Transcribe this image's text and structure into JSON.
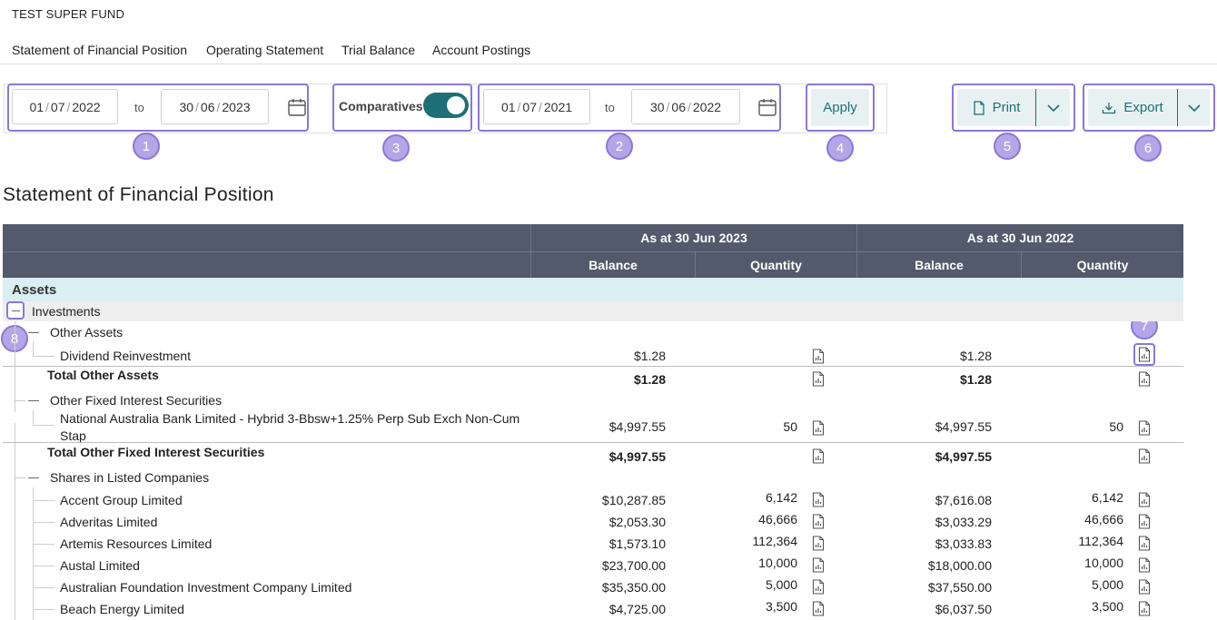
{
  "fund_name": "TEST SUPER FUND",
  "tabs": [
    {
      "label": "Statement of Financial Position"
    },
    {
      "label": "Operating Statement"
    },
    {
      "label": "Trial Balance"
    },
    {
      "label": "Account Postings"
    }
  ],
  "toolbar": {
    "period1": {
      "from_dd": "01",
      "from_mm": "07",
      "from_yyyy": "2022",
      "to_label": "to",
      "to_dd": "30",
      "to_mm": "06",
      "to_yyyy": "2023"
    },
    "comparatives_label": "Comparatives",
    "comparatives_on": true,
    "period2": {
      "from_dd": "01",
      "from_mm": "07",
      "from_yyyy": "2021",
      "to_label": "to",
      "to_dd": "30",
      "to_mm": "06",
      "to_yyyy": "2022"
    },
    "apply_label": "Apply",
    "print_label": "Print",
    "export_label": "Export",
    "date_sep": "/"
  },
  "badges": [
    "1",
    "2",
    "3",
    "4",
    "5",
    "6",
    "7",
    "8"
  ],
  "page_title": "Statement of Financial Position",
  "table": {
    "col_group_1": "As at 30 Jun 2023",
    "col_group_2": "As at 30 Jun 2022",
    "balance_label": "Balance",
    "quantity_label": "Quantity",
    "assets_label": "Assets",
    "investments_label": "Investments",
    "other_assets_label": "Other Assets",
    "dividend_row": {
      "name": "Dividend Reinvestment",
      "bal1": "$1.28",
      "qty1": "",
      "bal2": "$1.28",
      "qty2": ""
    },
    "total_other_assets": {
      "name": "Total Other Assets",
      "bal1": "$1.28",
      "bal2": "$1.28"
    },
    "ofis_label": "Other Fixed Interest Securities",
    "nab_row": {
      "name_line1": "National Australia Bank Limited - Hybrid 3-Bbsw+1.25% Perp Sub Exch Non-Cum",
      "name_line2": "Stap",
      "bal1": "$4,997.55",
      "qty1": "50",
      "bal2": "$4,997.55",
      "qty2": "50"
    },
    "total_ofis": {
      "name": "Total Other Fixed Interest Securities",
      "bal1": "$4,997.55",
      "bal2": "$4,997.55"
    },
    "shares_label": "Shares in Listed Companies",
    "shares": [
      {
        "name": "Accent Group Limited",
        "bal1": "$10,287.85",
        "qty1": "6,142",
        "bal2": "$7,616.08",
        "qty2": "6,142"
      },
      {
        "name": "Adveritas Limited",
        "bal1": "$2,053.30",
        "qty1": "46,666",
        "bal2": "$3,033.29",
        "qty2": "46,666"
      },
      {
        "name": "Artemis Resources Limited",
        "bal1": "$1,573.10",
        "qty1": "112,364",
        "bal2": "$3,033.83",
        "qty2": "112,364"
      },
      {
        "name": "Austal Limited",
        "bal1": "$23,700.00",
        "qty1": "10,000",
        "bal2": "$18,000.00",
        "qty2": "10,000"
      },
      {
        "name": "Australian Foundation Investment Company Limited",
        "bal1": "$35,350.00",
        "qty1": "5,000",
        "bal2": "$37,550.00",
        "qty2": "5,000"
      },
      {
        "name": "Beach Energy Limited",
        "bal1": "$4,725.00",
        "qty1": "3,500",
        "bal2": "$6,037.50",
        "qty2": "3,500"
      }
    ]
  },
  "colors": {
    "accent": "#1f6f76",
    "header_bg": "#525a6b",
    "highlight": "#8a77d8",
    "assets_bg": "#dbeef2"
  }
}
